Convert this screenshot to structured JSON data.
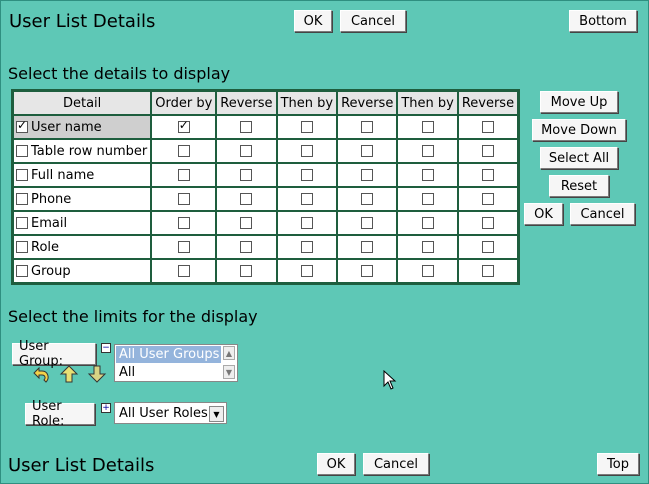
{
  "top": {
    "title": "User List Details",
    "ok_label": "OK",
    "cancel_label": "Cancel",
    "bottom_label": "Bottom"
  },
  "details_section": {
    "heading": "Select the details to display"
  },
  "table": {
    "headers": [
      "Detail",
      "Order by",
      "Reverse",
      "Then by",
      "Reverse",
      "Then by",
      "Reverse"
    ],
    "rows": [
      {
        "label": "User name",
        "checked": true,
        "order_by": true
      },
      {
        "label": "Table row number",
        "checked": false,
        "order_by": false
      },
      {
        "label": "Full name",
        "checked": false,
        "order_by": false
      },
      {
        "label": "Phone",
        "checked": false,
        "order_by": false
      },
      {
        "label": "Email",
        "checked": false,
        "order_by": false
      },
      {
        "label": "Role",
        "checked": false,
        "order_by": false
      },
      {
        "label": "Group",
        "checked": false,
        "order_by": false
      }
    ]
  },
  "side_buttons": {
    "move_up": "Move Up",
    "move_down": "Move Down",
    "select_all": "Select All",
    "reset": "Reset",
    "ok": "OK",
    "cancel": "Cancel"
  },
  "limits_section": {
    "heading": "Select the limits for the display"
  },
  "user_group": {
    "label": "User Group:",
    "options": [
      "All User Groups",
      "All"
    ],
    "selected": "All User Groups",
    "toggle": "−"
  },
  "user_role": {
    "label": "User Role:",
    "selected": "All User Roles",
    "toggle": "+"
  },
  "bottom": {
    "title": "User List Details",
    "ok_label": "OK",
    "cancel_label": "Cancel",
    "top_label": "Top"
  },
  "icons": [
    "undo-icon",
    "arrow-up-icon",
    "arrow-down-icon",
    "mouse-cursor-icon"
  ],
  "colors": {
    "background": "#5ec8b6",
    "table_border": "#1e5e3e",
    "selection": "#94b4dc"
  }
}
